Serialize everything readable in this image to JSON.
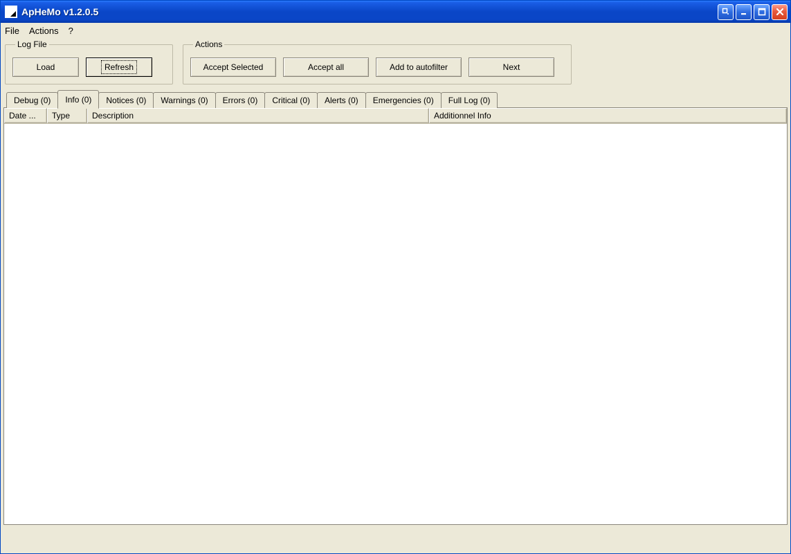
{
  "window": {
    "title": "ApHeMo v1.2.0.5"
  },
  "menu": {
    "file": "File",
    "actions": "Actions",
    "help": "?"
  },
  "groups": {
    "logfile": {
      "legend": "Log File",
      "load": "Load",
      "refresh": "Refresh"
    },
    "actions": {
      "legend": "Actions",
      "accept_selected": "Accept Selected",
      "accept_all": "Accept all",
      "add_autofilter": "Add to autofilter",
      "next": "Next"
    }
  },
  "tabs": {
    "debug": "Debug (0)",
    "info": "Info (0)",
    "notices": "Notices (0)",
    "warnings": "Warnings (0)",
    "errors": "Errors (0)",
    "critical": "Critical (0)",
    "alerts": "Alerts (0)",
    "emergencies": "Emergencies (0)",
    "full_log": "Full Log (0)",
    "active": "info"
  },
  "columns": {
    "date": "Date ...",
    "type": "Type",
    "description": "Description",
    "additional": "Additionnel Info"
  }
}
